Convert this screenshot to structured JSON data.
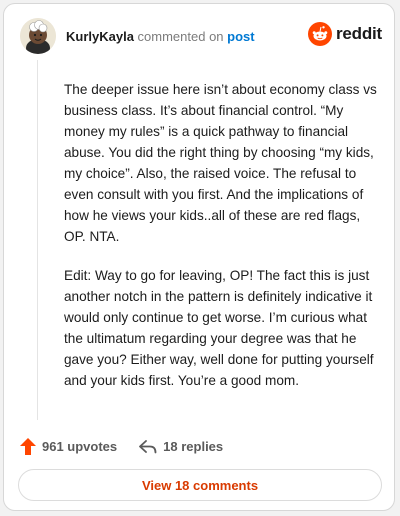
{
  "header": {
    "username": "KurlyKayla",
    "commented_on": "commented on",
    "post_link": "post",
    "brand": "reddit"
  },
  "comment": {
    "paragraphs": [
      "The deeper issue here isn’t about economy class vs business class. It’s about financial control. “My money my rules” is a quick pathway to financial abuse. You did the right thing by choosing “my kids, my choice”. Also, the raised voice. The refusal to even consult with you first. And the implications of how he views your kids..all of these are red flags, OP. NTA.",
      "Edit: Way to go for leaving, OP! The fact this is just another notch in the pattern is definitely indicative it would only continue to get worse. I’m curious what the ultimatum regarding your degree was that he gave you? Either way, well done for putting yourself and your kids first. You’re a good mom."
    ]
  },
  "actions": {
    "upvotes": "961 upvotes",
    "replies": "18 replies"
  },
  "view_comments": "View 18 comments",
  "colors": {
    "brand": "#ff4500",
    "upvote": "#ff4500",
    "link": "#0079d3",
    "view_button_text": "#d93a00"
  },
  "icons": {
    "avatar": "avatar-icon",
    "logo": "reddit-alien-icon",
    "upvote": "upvote-arrow-icon",
    "reply": "reply-arrow-icon"
  }
}
